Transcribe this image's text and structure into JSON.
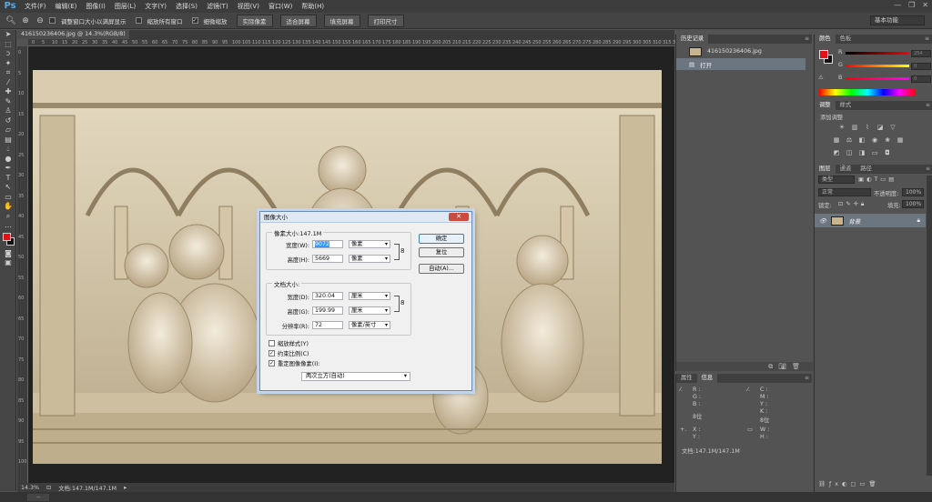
{
  "app": {
    "logo": "Ps"
  },
  "menu": [
    "文件(F)",
    "编辑(E)",
    "图像(I)",
    "图层(L)",
    "文字(Y)",
    "选择(S)",
    "滤镜(T)",
    "视图(V)",
    "窗口(W)",
    "帮助(H)"
  ],
  "options": {
    "resize_windows": "调整窗口大小以满屏显示",
    "zoom_all": "缩放所有窗口",
    "scrubby_zoom": "细微缩放",
    "actual_pixels": "实际像素",
    "fit_screen": "适合屏幕",
    "fill_screen": "填充屏幕",
    "print_size": "打印尺寸",
    "workspace": "基本功能"
  },
  "document": {
    "tab_title": "416150236406.jpg @ 14.3%(RGB/8)",
    "zoom": "14.3%",
    "doc_size": "文档:147.1M/147.1M",
    "ruler_h": [
      "0",
      "5",
      "10",
      "15",
      "20",
      "25",
      "30",
      "35",
      "40",
      "45",
      "50",
      "55",
      "60",
      "65",
      "70",
      "75",
      "80",
      "85",
      "90",
      "95",
      "100",
      "105",
      "110",
      "115",
      "120",
      "125",
      "130",
      "135",
      "140",
      "145",
      "150",
      "155",
      "160",
      "165",
      "170",
      "175",
      "180",
      "185",
      "190",
      "195",
      "200",
      "205",
      "210",
      "215",
      "220",
      "225",
      "230",
      "235",
      "240",
      "245",
      "250",
      "255",
      "260",
      "265",
      "270",
      "275",
      "280",
      "285",
      "290",
      "295",
      "300",
      "305",
      "310",
      "315",
      "320"
    ],
    "ruler_v": [
      "0",
      "5",
      "10",
      "15",
      "20",
      "25",
      "30",
      "35",
      "40",
      "45",
      "50",
      "55",
      "60",
      "65",
      "70",
      "75",
      "80",
      "85",
      "90",
      "95",
      "100"
    ]
  },
  "dialog": {
    "title": "图像大小",
    "pixel_group": "像素大小:147.1M",
    "width_label": "宽度(W):",
    "width_value": "9072",
    "height_label": "高度(H):",
    "height_value": "5669",
    "pixel_unit": "像素",
    "doc_group": "文档大小:",
    "doc_width_label": "宽度(D):",
    "doc_width_value": "320.04",
    "doc_height_label": "高度(G):",
    "doc_height_value": "199.99",
    "cm_unit": "厘米",
    "res_label": "分辨率(R):",
    "res_value": "72",
    "res_unit": "像素/英寸",
    "ok": "确定",
    "reset": "复位",
    "auto": "自动(A)...",
    "scale_styles": "缩放样式(Y)",
    "constrain": "约束比例(C)",
    "resample": "重定图像像素(I):",
    "resample_method": "两次立方(自动)",
    "close": "✕"
  },
  "history": {
    "tabs": [
      "历史记录"
    ],
    "snapshot": "416150236406.jpg",
    "state": "打开"
  },
  "info": {
    "tabs": [
      "属性",
      "信息"
    ],
    "r": "R :",
    "g": "G :",
    "b": "B :",
    "bit1": "8位",
    "c": "C :",
    "m": "M :",
    "y": "Y :",
    "k": "K :",
    "bit2": "8位",
    "x": "X :",
    "yy": "Y :",
    "w": "W :",
    "h": "H :",
    "doc": "文档:147.1M/147.1M"
  },
  "color": {
    "tabs": [
      "颜色",
      "色板"
    ],
    "r": "R",
    "g": "G",
    "b": "B",
    "r_val": "254",
    "g_val": "0",
    "b_val": "0",
    "fg": "#e50f14",
    "bg": "#111111"
  },
  "adjust": {
    "tabs": [
      "调整",
      "样式"
    ],
    "add": "添加调整"
  },
  "layers": {
    "tabs": [
      "图层",
      "通道",
      "路径"
    ],
    "kind": "类型",
    "mode": "正常",
    "opacity_label": "不透明度:",
    "opacity": "100%",
    "lock_label": "锁定:",
    "fill_label": "填充:",
    "fill": "100%",
    "layer_name": "背景"
  }
}
